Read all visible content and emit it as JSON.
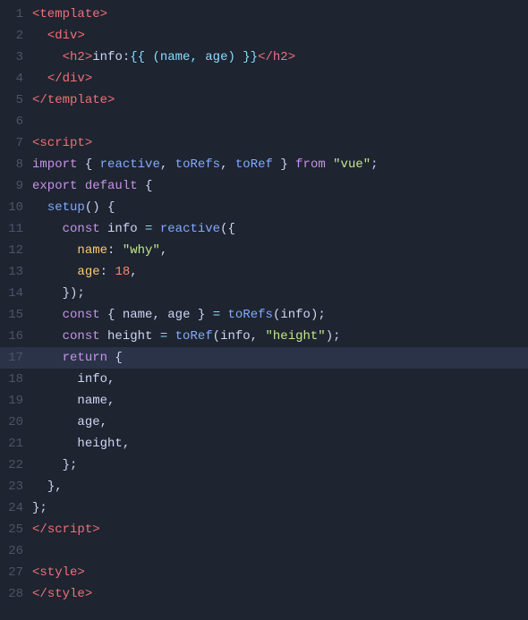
{
  "lines": [
    {
      "num": 1,
      "tokens": [
        {
          "t": "<",
          "c": "tag"
        },
        {
          "t": "template",
          "c": "tag"
        },
        {
          "t": ">",
          "c": "tag"
        }
      ]
    },
    {
      "num": 2,
      "tokens": [
        {
          "t": "  ",
          "c": "plain"
        },
        {
          "t": "<",
          "c": "tag"
        },
        {
          "t": "div",
          "c": "tag"
        },
        {
          "t": ">",
          "c": "tag"
        }
      ]
    },
    {
      "num": 3,
      "tokens": [
        {
          "t": "    ",
          "c": "plain"
        },
        {
          "t": "<",
          "c": "tag"
        },
        {
          "t": "h2",
          "c": "tag"
        },
        {
          "t": ">",
          "c": "tag"
        },
        {
          "t": "info:",
          "c": "plain"
        },
        {
          "t": "{{ (name, age) }}",
          "c": "tmpl"
        },
        {
          "t": "</",
          "c": "tag"
        },
        {
          "t": "h2",
          "c": "tag"
        },
        {
          "t": ">",
          "c": "tag"
        }
      ]
    },
    {
      "num": 4,
      "tokens": [
        {
          "t": "  ",
          "c": "plain"
        },
        {
          "t": "</",
          "c": "tag"
        },
        {
          "t": "div",
          "c": "tag"
        },
        {
          "t": ">",
          "c": "tag"
        }
      ]
    },
    {
      "num": 5,
      "tokens": [
        {
          "t": "</",
          "c": "tag"
        },
        {
          "t": "template",
          "c": "tag"
        },
        {
          "t": ">",
          "c": "tag"
        }
      ]
    },
    {
      "num": 6,
      "tokens": []
    },
    {
      "num": 7,
      "tokens": [
        {
          "t": "<",
          "c": "tag"
        },
        {
          "t": "script",
          "c": "tag"
        },
        {
          "t": ">",
          "c": "tag"
        }
      ]
    },
    {
      "num": 8,
      "tokens": [
        {
          "t": "import",
          "c": "kw"
        },
        {
          "t": " { ",
          "c": "plain"
        },
        {
          "t": "reactive",
          "c": "fn"
        },
        {
          "t": ", ",
          "c": "plain"
        },
        {
          "t": "toRefs",
          "c": "fn"
        },
        {
          "t": ", ",
          "c": "plain"
        },
        {
          "t": "toRef",
          "c": "fn"
        },
        {
          "t": " } ",
          "c": "plain"
        },
        {
          "t": "from",
          "c": "kw"
        },
        {
          "t": " ",
          "c": "plain"
        },
        {
          "t": "\"vue\"",
          "c": "str"
        },
        {
          "t": ";",
          "c": "plain"
        }
      ]
    },
    {
      "num": 9,
      "tokens": [
        {
          "t": "export",
          "c": "kw"
        },
        {
          "t": " ",
          "c": "plain"
        },
        {
          "t": "default",
          "c": "kw"
        },
        {
          "t": " {",
          "c": "plain"
        }
      ]
    },
    {
      "num": 10,
      "tokens": [
        {
          "t": "  ",
          "c": "plain"
        },
        {
          "t": "setup",
          "c": "fn"
        },
        {
          "t": "() {",
          "c": "plain"
        }
      ]
    },
    {
      "num": 11,
      "tokens": [
        {
          "t": "    ",
          "c": "plain"
        },
        {
          "t": "const",
          "c": "kw"
        },
        {
          "t": " info ",
          "c": "plain"
        },
        {
          "t": "=",
          "c": "punct"
        },
        {
          "t": " ",
          "c": "plain"
        },
        {
          "t": "reactive",
          "c": "fn"
        },
        {
          "t": "({",
          "c": "plain"
        }
      ]
    },
    {
      "num": 12,
      "tokens": [
        {
          "t": "      ",
          "c": "plain"
        },
        {
          "t": "name",
          "c": "prop"
        },
        {
          "t": ": ",
          "c": "plain"
        },
        {
          "t": "\"why\"",
          "c": "str"
        },
        {
          "t": ",",
          "c": "plain"
        }
      ]
    },
    {
      "num": 13,
      "tokens": [
        {
          "t": "      ",
          "c": "plain"
        },
        {
          "t": "age",
          "c": "prop"
        },
        {
          "t": ": ",
          "c": "plain"
        },
        {
          "t": "18",
          "c": "num"
        },
        {
          "t": ",",
          "c": "plain"
        }
      ]
    },
    {
      "num": 14,
      "tokens": [
        {
          "t": "    ",
          "c": "plain"
        },
        {
          "t": "});",
          "c": "plain"
        }
      ]
    },
    {
      "num": 15,
      "tokens": [
        {
          "t": "    ",
          "c": "plain"
        },
        {
          "t": "const",
          "c": "kw"
        },
        {
          "t": " { ",
          "c": "plain"
        },
        {
          "t": "name",
          "c": "plain"
        },
        {
          "t": ", ",
          "c": "plain"
        },
        {
          "t": "age",
          "c": "plain"
        },
        {
          "t": " } ",
          "c": "plain"
        },
        {
          "t": "=",
          "c": "punct"
        },
        {
          "t": " ",
          "c": "plain"
        },
        {
          "t": "toRefs",
          "c": "fn"
        },
        {
          "t": "(info);",
          "c": "plain"
        }
      ]
    },
    {
      "num": 16,
      "tokens": [
        {
          "t": "    ",
          "c": "plain"
        },
        {
          "t": "const",
          "c": "kw"
        },
        {
          "t": " height ",
          "c": "plain"
        },
        {
          "t": "=",
          "c": "punct"
        },
        {
          "t": " ",
          "c": "plain"
        },
        {
          "t": "toRef",
          "c": "fn"
        },
        {
          "t": "(info, ",
          "c": "plain"
        },
        {
          "t": "\"height\"",
          "c": "str"
        },
        {
          "t": ");",
          "c": "plain"
        }
      ]
    },
    {
      "num": 17,
      "tokens": [
        {
          "t": "    ",
          "c": "plain"
        },
        {
          "t": "return",
          "c": "kw"
        },
        {
          "t": " {",
          "c": "plain"
        }
      ],
      "highlight": true
    },
    {
      "num": 18,
      "tokens": [
        {
          "t": "      ",
          "c": "plain"
        },
        {
          "t": "info",
          "c": "plain"
        },
        {
          "t": ",",
          "c": "plain"
        }
      ]
    },
    {
      "num": 19,
      "tokens": [
        {
          "t": "      ",
          "c": "plain"
        },
        {
          "t": "name",
          "c": "plain"
        },
        {
          "t": ",",
          "c": "plain"
        }
      ]
    },
    {
      "num": 20,
      "tokens": [
        {
          "t": "      ",
          "c": "plain"
        },
        {
          "t": "age",
          "c": "plain"
        },
        {
          "t": ",",
          "c": "plain"
        }
      ]
    },
    {
      "num": 21,
      "tokens": [
        {
          "t": "      ",
          "c": "plain"
        },
        {
          "t": "height",
          "c": "plain"
        },
        {
          "t": ",",
          "c": "plain"
        }
      ]
    },
    {
      "num": 22,
      "tokens": [
        {
          "t": "    ",
          "c": "plain"
        },
        {
          "t": "};",
          "c": "plain"
        }
      ]
    },
    {
      "num": 23,
      "tokens": [
        {
          "t": "  ",
          "c": "plain"
        },
        {
          "t": "},",
          "c": "plain"
        }
      ]
    },
    {
      "num": 24,
      "tokens": [
        {
          "t": "};",
          "c": "plain"
        }
      ]
    },
    {
      "num": 25,
      "tokens": [
        {
          "t": "</",
          "c": "tag"
        },
        {
          "t": "script",
          "c": "tag"
        },
        {
          "t": ">",
          "c": "tag"
        }
      ]
    },
    {
      "num": 26,
      "tokens": []
    },
    {
      "num": 27,
      "tokens": [
        {
          "t": "<",
          "c": "tag"
        },
        {
          "t": "style",
          "c": "tag"
        },
        {
          "t": ">",
          "c": "tag"
        }
      ]
    },
    {
      "num": 28,
      "tokens": [
        {
          "t": "</",
          "c": "tag"
        },
        {
          "t": "style",
          "c": "tag"
        },
        {
          "t": ">",
          "c": "tag"
        }
      ]
    }
  ]
}
